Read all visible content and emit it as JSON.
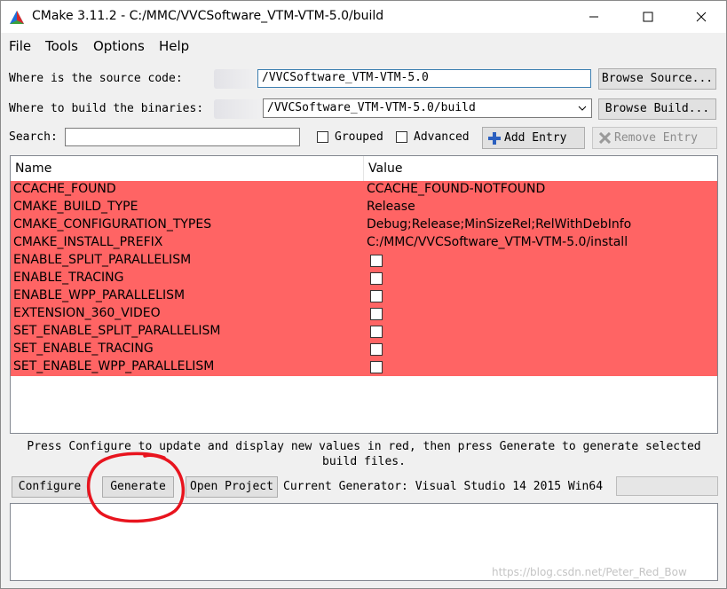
{
  "window": {
    "title": "CMake 3.11.2 - C:/MMC/VVCSoftware_VTM-VTM-5.0/build"
  },
  "menu": [
    "File",
    "Tools",
    "Options",
    "Help"
  ],
  "source": {
    "label": "Where is the source code:",
    "value": "/VVCSoftware_VTM-VTM-5.0",
    "browse_label": "Browse Source..."
  },
  "build": {
    "label": "Where to build the binaries:",
    "value": "/VVCSoftware_VTM-VTM-5.0/build",
    "browse_label": "Browse Build..."
  },
  "search": {
    "label": "Search:",
    "value": "",
    "grouped_label": "Grouped",
    "advanced_label": "Advanced",
    "add_label": "Add Entry",
    "remove_label": "Remove Entry"
  },
  "table": {
    "headers": [
      "Name",
      "Value"
    ],
    "rows": [
      {
        "name": "CCACHE_FOUND",
        "value": "CCACHE_FOUND-NOTFOUND",
        "kind": "text"
      },
      {
        "name": "CMAKE_BUILD_TYPE",
        "value": "Release",
        "kind": "text"
      },
      {
        "name": "CMAKE_CONFIGURATION_TYPES",
        "value": "Debug;Release;MinSizeRel;RelWithDebInfo",
        "kind": "text"
      },
      {
        "name": "CMAKE_INSTALL_PREFIX",
        "value": "C:/MMC/VVCSoftware_VTM-VTM-5.0/install",
        "kind": "text"
      },
      {
        "name": "ENABLE_SPLIT_PARALLELISM",
        "value": "",
        "kind": "bool"
      },
      {
        "name": "ENABLE_TRACING",
        "value": "",
        "kind": "bool"
      },
      {
        "name": "ENABLE_WPP_PARALLELISM",
        "value": "",
        "kind": "bool"
      },
      {
        "name": "EXTENSION_360_VIDEO",
        "value": "",
        "kind": "bool"
      },
      {
        "name": "SET_ENABLE_SPLIT_PARALLELISM",
        "value": "",
        "kind": "bool"
      },
      {
        "name": "SET_ENABLE_TRACING",
        "value": "",
        "kind": "bool"
      },
      {
        "name": "SET_ENABLE_WPP_PARALLELISM",
        "value": "",
        "kind": "bool"
      }
    ]
  },
  "message": {
    "line1": "Press Configure to update and display new values in red, then press Generate to generate selected",
    "line2": "build files."
  },
  "actions": {
    "configure_label": "Configure",
    "generate_label": "Generate",
    "open_project_label": "Open Project",
    "generator_text": "Current Generator: Visual Studio 14 2015 Win64"
  },
  "watermark": "https://blog.csdn.net/Peter_Red_Bow",
  "colors": {
    "new_value_row": "#ff6464",
    "annotation_circle": "#e8141e"
  },
  "icons": {
    "app": "cmake-triangle-icon",
    "add": "plus-icon",
    "remove": "x-icon"
  }
}
